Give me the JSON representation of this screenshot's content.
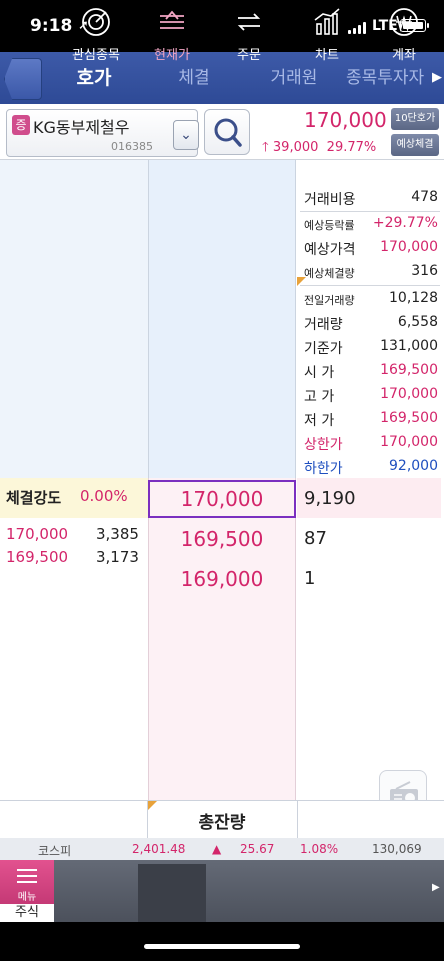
{
  "status_bar": {
    "time": "9:18",
    "network": "LTE"
  },
  "tabs": [
    {
      "label": "호가"
    },
    {
      "label": "체결"
    },
    {
      "label": "거래원"
    },
    {
      "label": "종목투자자"
    }
  ],
  "stock": {
    "market_badge": "증",
    "name": "KG동부제철우",
    "code": "016385",
    "price": "170,000",
    "change": "39,000",
    "change_pct": "29.77%",
    "btn_ten": "10단호가",
    "btn_expected": "예상체결"
  },
  "info": [
    {
      "label": "거래비용",
      "value": "478"
    },
    {
      "label": "예상등락률",
      "value": "+29.77%"
    },
    {
      "label": "예상가격",
      "value": "170,000"
    },
    {
      "label": "예상체결량",
      "value": "316"
    },
    {
      "label": "전일거래량",
      "value": "10,128"
    },
    {
      "label": "거래량",
      "value": "6,558"
    },
    {
      "label": "기준가",
      "value": "131,000"
    },
    {
      "label": "시 가",
      "value": "169,500"
    },
    {
      "label": "고 가",
      "value": "170,000"
    },
    {
      "label": "저 가",
      "value": "169,500"
    },
    {
      "label": "상한가",
      "value": "170,000"
    },
    {
      "label": "하한가",
      "value": "92,000"
    }
  ],
  "strength": {
    "label": "체결강도",
    "value": "0.00%"
  },
  "trades": [
    {
      "price": "170,000",
      "volume": "3,385"
    },
    {
      "price": "169,500",
      "volume": "3,173"
    }
  ],
  "asks": [
    {
      "price": "170,000",
      "qty": "9,190"
    },
    {
      "price": "169,500",
      "qty": "87"
    },
    {
      "price": "169,000",
      "qty": "1"
    }
  ],
  "total_label": "총잔량",
  "ticker": {
    "name": "코스피",
    "value": "2,401.48",
    "change": "25.67",
    "pct": "1.08%",
    "volume": "130,069"
  },
  "nav": {
    "menu": "메뉴",
    "menu_sub": "주식",
    "items": [
      "관심종목",
      "현재가",
      "주문",
      "차트",
      "계좌"
    ]
  },
  "colors": {
    "up": "#d3256a",
    "down": "#1f4fbf",
    "tab_bg": "#3d5aa8",
    "highlight": "#7b2fc0"
  }
}
